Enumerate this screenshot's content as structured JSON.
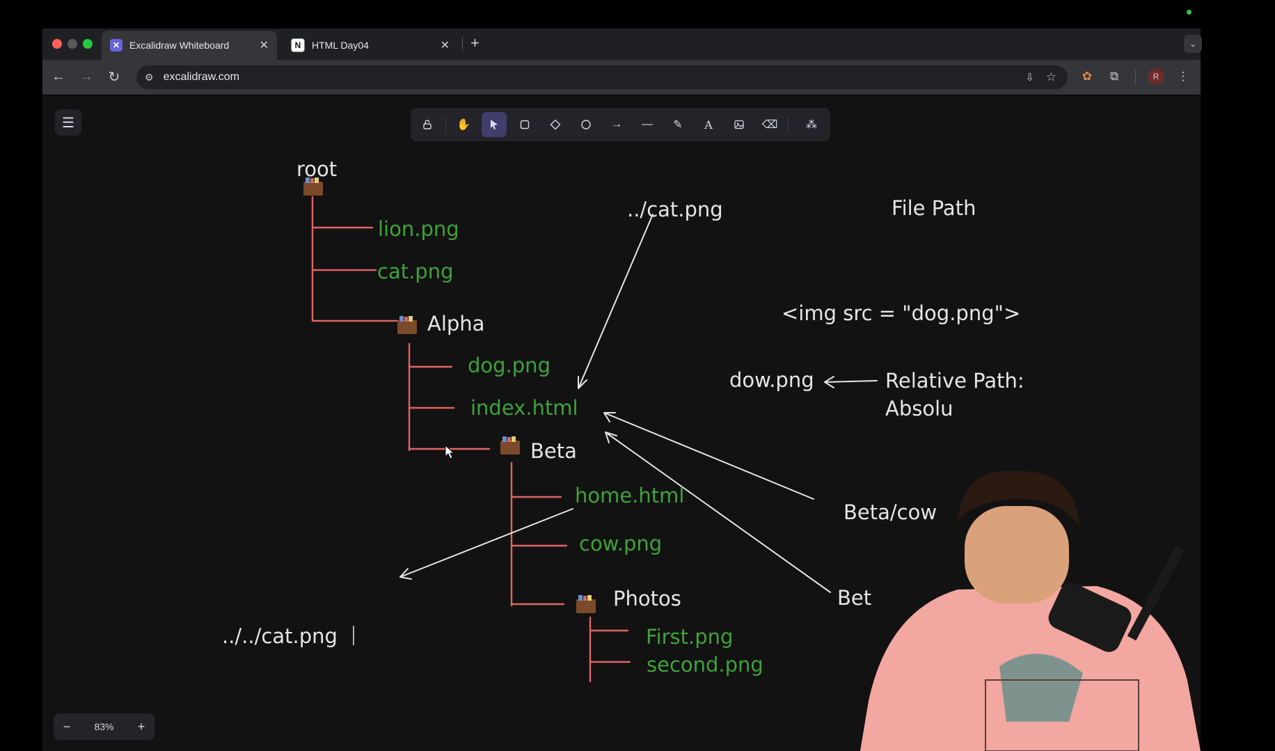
{
  "browser": {
    "tabs": [
      {
        "label": "Excalidraw Whiteboard",
        "active": true
      },
      {
        "label": "HTML Day04",
        "active": false
      }
    ],
    "new_tab_label": "+",
    "url": "excalidraw.com",
    "profile_initial": "R"
  },
  "excalidraw": {
    "zoom": "83%",
    "zoom_minus": "−",
    "zoom_plus": "+",
    "tools": [
      "lock",
      "hand",
      "selection",
      "rectangle",
      "diamond",
      "ellipse",
      "arrow",
      "line",
      "draw",
      "text",
      "image",
      "eraser",
      "more-tools"
    ],
    "selected_tool": "selection"
  },
  "diagram": {
    "root": "root",
    "lion": "lion.png",
    "cat": "cat.png",
    "alpha": "Alpha",
    "dog": "dog.png",
    "index": "index.html",
    "beta": "Beta",
    "home": "home.html",
    "cow": "cow.png",
    "photos": "Photos",
    "first": "First.png",
    "second": "second.png",
    "rel_cat": "../cat.png",
    "file_path": "File Path",
    "img_tag": "<img src = \"dog.png\">",
    "dow": "dow.png",
    "relative_path": "Relative Path:",
    "absolute_path": "Absolu",
    "beta_cow": "Beta/cow",
    "beta_short": "Bet",
    "rel_rel_cat": "../../cat.png"
  },
  "colors": {
    "green_text": "#3ea33a",
    "white_text": "#e6e6e6",
    "tree_line": "#e16464",
    "canvas_bg": "#121212"
  }
}
